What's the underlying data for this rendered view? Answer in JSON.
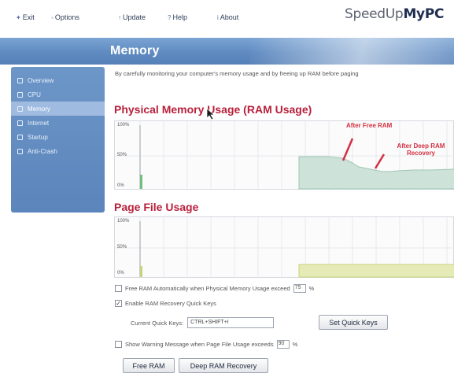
{
  "menu": {
    "items": [
      {
        "glyph": "✦",
        "label": "Exit"
      },
      {
        "glyph": "◦",
        "label": "Options"
      },
      {
        "glyph": "↑",
        "label": "Update"
      },
      {
        "glyph": "?",
        "label": "Help"
      },
      {
        "glyph": "i",
        "label": "About"
      }
    ],
    "logo_part1": "SpeedUp",
    "logo_part2": "MyPC"
  },
  "header": {
    "title": "Memory"
  },
  "sidebar": {
    "items": [
      {
        "label": "Overview",
        "active": false
      },
      {
        "label": "CPU",
        "active": false
      },
      {
        "label": "Memory",
        "active": true
      },
      {
        "label": "Internet",
        "active": false
      },
      {
        "label": "Startup",
        "active": false
      },
      {
        "label": "Anti-Crash",
        "active": false
      }
    ]
  },
  "main": {
    "intro": "By carefully monitoring your computer's memory usage and by freeing up RAM before paging",
    "physical_title": "Physical Memory Usage (RAM Usage)",
    "pagefile_title": "Page File Usage",
    "y_ticks": {
      "top": "100%",
      "mid": "50%",
      "bottom": "0%"
    },
    "annotation_free": "After Free RAM",
    "annotation_deep": "After Deep RAM Recovery",
    "options": {
      "auto_free_label": "Free RAM Automatically when Physical Memory Usage exceed",
      "auto_free_checked": false,
      "auto_free_value": "75",
      "percent": "%",
      "quick_keys_label": "Enable RAM Recovery Quick Keys",
      "quick_keys_checked": true,
      "current_keys_label": "Current Quick Keys:",
      "current_keys_value": "CTRL+SHIFT+I",
      "set_keys_button": "Set Quick Keys",
      "warning_label": "Show Warning Message when Page File Usage exceeds",
      "warning_checked": false,
      "warning_value": "90"
    },
    "buttons": {
      "free_ram": "Free RAM",
      "deep_recovery": "Deep RAM Recovery"
    }
  },
  "colors": {
    "accent_red": "#b8203b",
    "header_blue": "#5f8bc1",
    "ram_fill": "#cde3da",
    "pagefile_fill": "#e5ebb6"
  }
}
